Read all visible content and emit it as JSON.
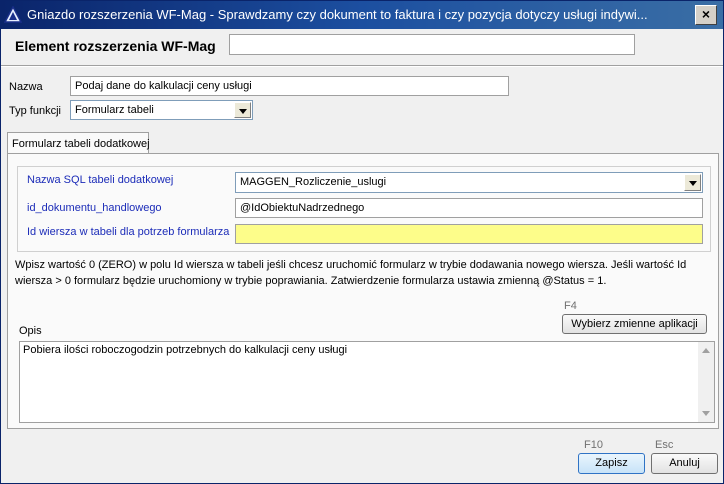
{
  "window": {
    "title": "Gniazdo rozszerzenia WF-Mag - Sprawdzamy czy dokument to faktura i czy pozycja dotyczy usługi indywi...",
    "close_label": "×"
  },
  "header": {
    "label": "Element rozszerzenia WF-Mag",
    "value": ""
  },
  "form": {
    "nazwa_label": "Nazwa",
    "nazwa_value": "Podaj dane do kalkulacji ceny usługi",
    "typ_label": "Typ funkcji",
    "typ_value": "Formularz tabeli"
  },
  "tab": {
    "label": "Formularz tabeli dodatkowej"
  },
  "panel": {
    "sql_label": "Nazwa SQL tabeli dodatkowej",
    "sql_value": "MAGGEN_Rozliczenie_uslugi",
    "id_dok_label": "id_dokumentu_handlowego",
    "id_dok_value": "@IdObiektuNadrzednego",
    "id_wiersza_label": "Id wiersza w tabeli dla potrzeb formularza",
    "id_wiersza_value": "",
    "info_text": "Wpisz wartość 0 (ZERO) w polu Id wiersza w tabeli jeśli chcesz uruchomić formularz w trybie dodawania nowego wiersza. Jeśli wartość Id wiersza > 0  formularz będzie uruchomiony w trybie poprawiania. Zatwierdzenie formularza ustawia zmienną @Status = 1.",
    "f4_label": "F4",
    "wybierz_label": "Wybierz zmienne aplikacji",
    "opis_label": "Opis",
    "opis_value": "Pobiera ilości roboczogodzin potrzebnych do kalkulacji ceny usługi"
  },
  "footer": {
    "f10_label": "F10",
    "esc_label": "Esc",
    "zapisz_label": "Zapisz",
    "anuluj_label": "Anuluj"
  },
  "colors": {
    "accent_blue": "#1c2cb8",
    "highlight_yellow": "#fdfd8a",
    "titlebar": "#0a246a"
  }
}
